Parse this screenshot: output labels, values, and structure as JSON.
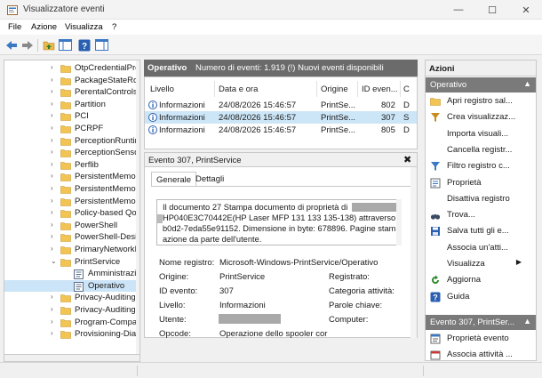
{
  "window": {
    "title": "Visualizzatore eventi",
    "minimize": "—",
    "maximize": "☐",
    "close": "✕"
  },
  "menu": [
    "File",
    "Azione",
    "Visualizza",
    "?"
  ],
  "tree": {
    "items": [
      {
        "label": "OtpCredentialProvider",
        "level": 1
      },
      {
        "label": "PackageStateRoaming",
        "level": 1
      },
      {
        "label": "PerentalControls",
        "level": 1
      },
      {
        "label": "Partition",
        "level": 1
      },
      {
        "label": "PCI",
        "level": 1
      },
      {
        "label": "PCRPF",
        "level": 1
      },
      {
        "label": "PerceptionRuntime",
        "level": 1
      },
      {
        "label": "PerceptionSensorDataService",
        "level": 1
      },
      {
        "label": "Perflib",
        "level": 1
      },
      {
        "label": "PersistentMemory-Nvdimm",
        "level": 1
      },
      {
        "label": "PersistentMemory-PmemDisk",
        "level": 1
      },
      {
        "label": "PersistentMemory-ScmBus",
        "level": 1
      },
      {
        "label": "Policy-based QoS",
        "level": 1
      },
      {
        "label": "PowerShell",
        "level": 1
      },
      {
        "label": "PowerShell-DesiredStateConfiguration",
        "level": 1
      },
      {
        "label": "PrimaryNetworkIcon",
        "level": 1
      },
      {
        "label": "PrintService",
        "level": 1,
        "expanded": true
      },
      {
        "label": "Amministrazione",
        "level": 2
      },
      {
        "label": "Operativo",
        "level": 2,
        "selected": true
      },
      {
        "label": "Privacy-Auditing",
        "level": 1
      },
      {
        "label": "Privacy-Auditing",
        "level": 1
      },
      {
        "label": "Program-Compatibility-Assistant",
        "level": 1
      },
      {
        "label": "Provisioning-Diagnostics",
        "level": 1
      }
    ]
  },
  "events_header": {
    "title": "Operativo",
    "count": "Numero di eventi: 1.919 (!) Nuovi eventi disponibili"
  },
  "events_table": {
    "columns": [
      "Livello",
      "Data e ora",
      "Origine",
      "ID even...",
      "C"
    ],
    "rows": [
      {
        "level": "Informazioni",
        "datetime": "24/08/2026 15:46:57",
        "source": "PrintSe...",
        "id": "802",
        "cat": "D"
      },
      {
        "level": "Informazioni",
        "datetime": "24/08/2026 15:46:57",
        "source": "PrintSe...",
        "id": "307",
        "cat": "S"
      },
      {
        "level": "Informazioni",
        "datetime": "24/08/2026 15:46:57",
        "source": "PrintSe...",
        "id": "805",
        "cat": "D"
      }
    ]
  },
  "detail": {
    "title": "Evento 307, PrintService",
    "close": "✖",
    "tabs": [
      "Generale",
      "Dettagli"
    ],
    "message_lines": [
      "Il documento 27 Stampa documento di proprietà di",
      "HP040E3C70442E(HP Laser MFP 131 133 135-138) attraverso la por",
      "b0d2-7eda55e91152. Dimensione in byte: 678896. Pagine stampat",
      "azione da parte dell'utente."
    ],
    "fields": {
      "log_name_label": "Nome registro:",
      "log_name_value": "Microsoft-Windows-PrintService/Operativo",
      "source_label": "Origine:",
      "source_value": "PrintService",
      "logged_label": "Registrato:",
      "event_id_label": "ID evento:",
      "event_id_value": "307",
      "task_cat_label": "Categoria attività:",
      "level_label": "Livello:",
      "level_value": "Informazioni",
      "keywords_label": "Parole chiave:",
      "user_label": "Utente:",
      "computer_label": "Computer:",
      "opcode_label": "Opcode:",
      "opcode_value": "Operazione dello spooler cor"
    }
  },
  "actions": {
    "title": "Azioni",
    "section1": "Operativo",
    "items1": [
      {
        "label": "Apri registro sal...",
        "icon": "open-folder-icon"
      },
      {
        "label": "Crea visualizzaz...",
        "icon": "filter-create-icon"
      },
      {
        "label": "Importa visuali...",
        "icon": ""
      },
      {
        "label": "Cancella registr...",
        "icon": ""
      },
      {
        "label": "Filtro registro c...",
        "icon": "filter-icon"
      },
      {
        "label": "Proprietà",
        "icon": "properties-icon"
      },
      {
        "label": "Disattiva registro",
        "icon": ""
      },
      {
        "label": "Trova...",
        "icon": "binoculars-icon"
      },
      {
        "label": "Salva tutti gli e...",
        "icon": "save-icon"
      },
      {
        "label": "Associa un'atti...",
        "icon": ""
      },
      {
        "label": "Visualizza",
        "icon": "",
        "submenu": true
      },
      {
        "label": "Aggiorna",
        "icon": "refresh-icon"
      },
      {
        "label": "Guida",
        "icon": "help-icon"
      }
    ],
    "section2": "Evento 307, PrintSer...",
    "items2": [
      {
        "label": "Proprietà evento",
        "icon": "event-properties-icon"
      },
      {
        "label": "Associa attività ...",
        "icon": "task-icon"
      }
    ]
  },
  "colors": {
    "accent": "#3b78c4",
    "header_dark": "#6b6b6b",
    "action_section": "#7a7a7a",
    "selection": "#cce4f7"
  }
}
